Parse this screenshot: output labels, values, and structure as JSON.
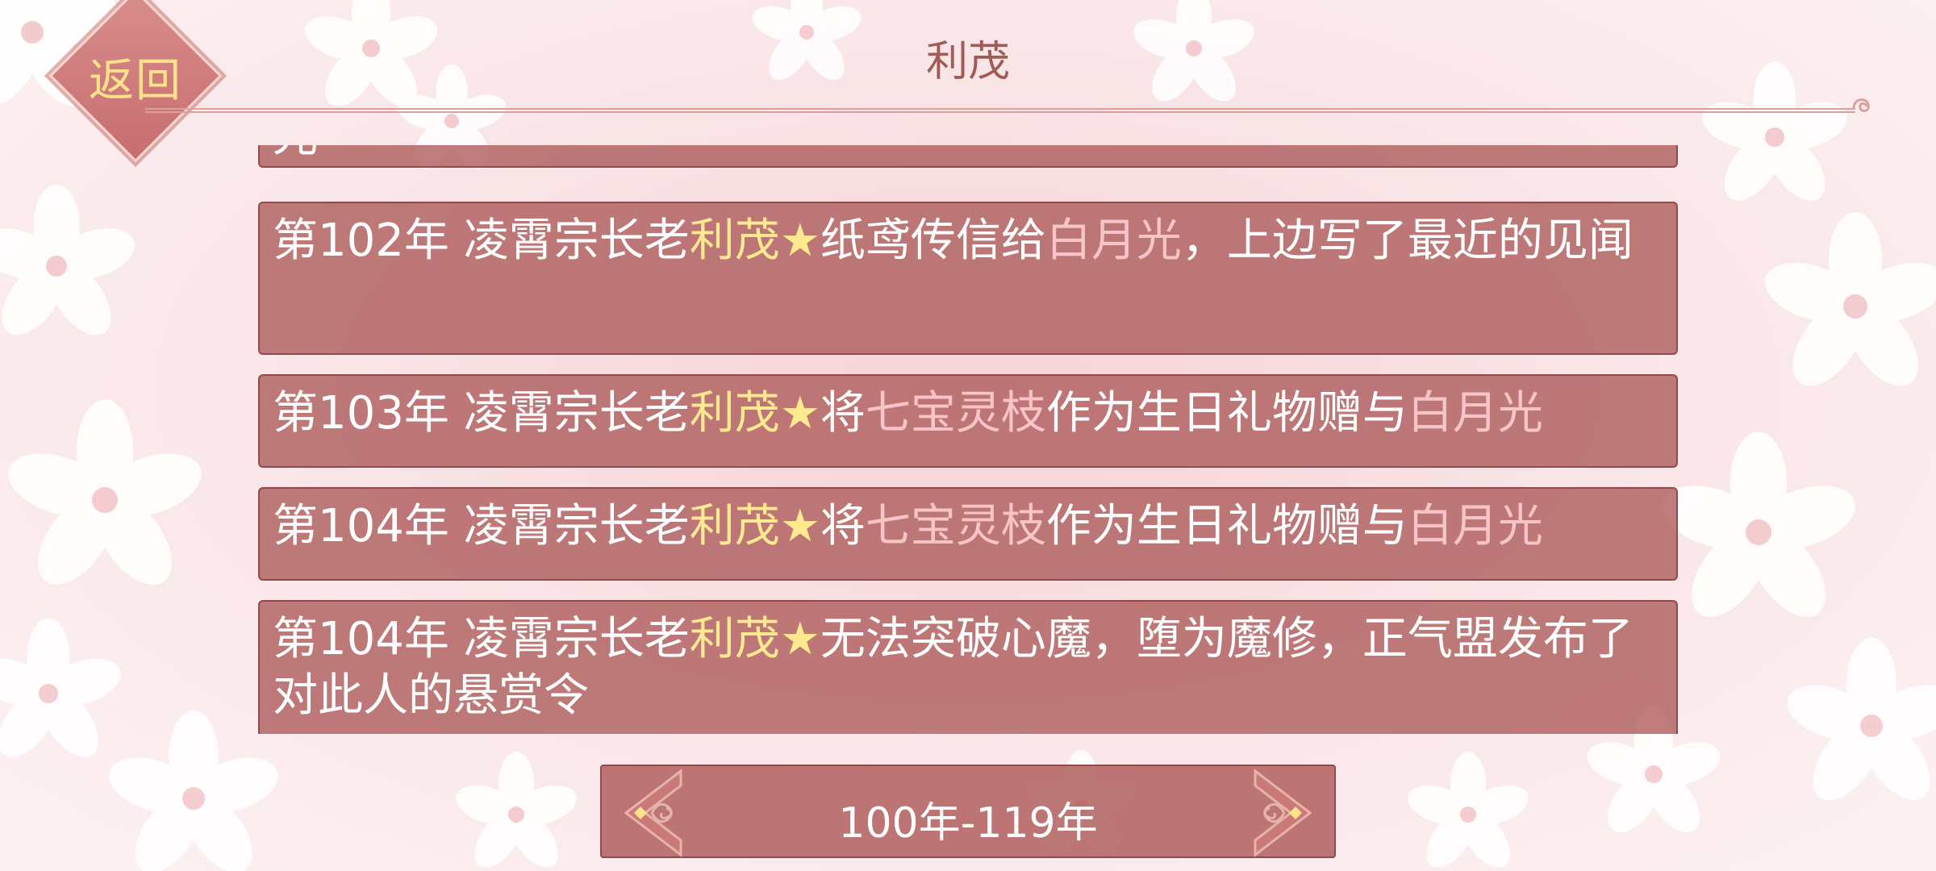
{
  "header": {
    "back_label": "返回",
    "title": "利茂"
  },
  "events": [
    {
      "segments": [
        {
          "text": "光",
          "style": "normal"
        }
      ]
    },
    {
      "segments": [
        {
          "text": "第102年 凌霄宗长老",
          "style": "normal"
        },
        {
          "text": "利茂",
          "style": "hl"
        },
        {
          "text": "★",
          "style": "hl"
        },
        {
          "text": "纸鸢传信给",
          "style": "normal"
        },
        {
          "text": "白月光",
          "style": "pink"
        },
        {
          "text": "，上边写了最近的见闻",
          "style": "normal"
        }
      ]
    },
    {
      "segments": [
        {
          "text": "第103年 凌霄宗长老",
          "style": "normal"
        },
        {
          "text": "利茂",
          "style": "hl"
        },
        {
          "text": "★",
          "style": "hl"
        },
        {
          "text": "将",
          "style": "normal"
        },
        {
          "text": "七宝灵枝",
          "style": "pink"
        },
        {
          "text": "作为生日礼物赠与",
          "style": "normal"
        },
        {
          "text": "白月光",
          "style": "pink"
        }
      ]
    },
    {
      "segments": [
        {
          "text": "第104年 凌霄宗长老",
          "style": "normal"
        },
        {
          "text": "利茂",
          "style": "hl"
        },
        {
          "text": "★",
          "style": "hl"
        },
        {
          "text": "将",
          "style": "normal"
        },
        {
          "text": "七宝灵枝",
          "style": "pink"
        },
        {
          "text": "作为生日礼物赠与",
          "style": "normal"
        },
        {
          "text": "白月光",
          "style": "pink"
        }
      ]
    },
    {
      "segments": [
        {
          "text": "第104年 凌霄宗长老",
          "style": "normal"
        },
        {
          "text": "利茂",
          "style": "hl"
        },
        {
          "text": "★",
          "style": "hl"
        },
        {
          "text": "无法突破心魔，堕为魔修，正气盟发布了对此人的悬赏令",
          "style": "normal"
        }
      ]
    }
  ],
  "pager": {
    "label": "100年-119年"
  },
  "colors": {
    "card_bg": "#b05f5f",
    "highlight_name": "#ffea8f",
    "highlight_pink": "#f7c4c8",
    "title": "#a15a55",
    "back_text": "#ffe28a"
  },
  "icons": {
    "pager_left": "ornate-left-arrow-icon",
    "pager_right": "ornate-right-arrow-icon",
    "rule_tip": "cloud-scroll-icon"
  }
}
